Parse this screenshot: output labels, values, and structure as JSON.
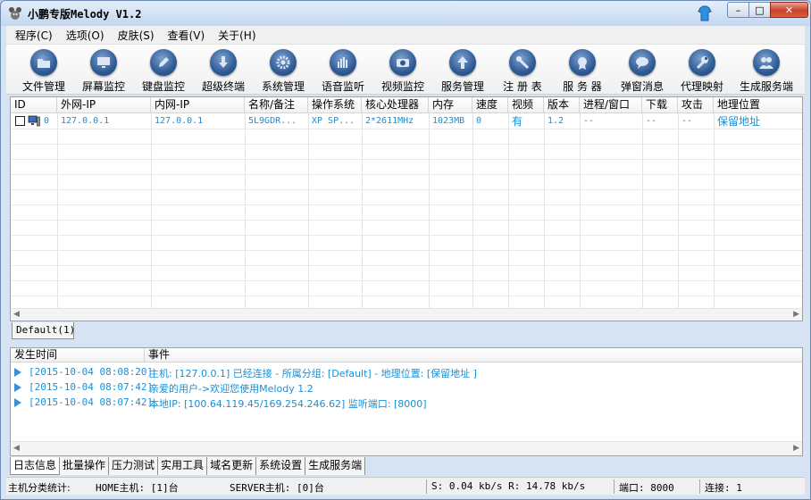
{
  "window": {
    "title": "小鹏专版Melody V1.2",
    "buttons": {
      "minimize": "–",
      "maximize": "□",
      "close": "✕"
    }
  },
  "menu": [
    {
      "label": "程序(C)"
    },
    {
      "label": "选项(O)"
    },
    {
      "label": "皮肤(S)"
    },
    {
      "label": "查看(V)"
    },
    {
      "label": "关于(H)"
    }
  ],
  "toolbar": [
    {
      "label": "文件管理",
      "icon": "folder-icon"
    },
    {
      "label": "屏幕监控",
      "icon": "monitor-icon"
    },
    {
      "label": "键盘监控",
      "icon": "pencil-icon"
    },
    {
      "label": "超级终端",
      "icon": "download-arrow-icon"
    },
    {
      "label": "系统管理",
      "icon": "gear-icon"
    },
    {
      "label": "语音监听",
      "icon": "equalizer-icon"
    },
    {
      "label": "视频监控",
      "icon": "camera-icon"
    },
    {
      "label": "服务管理",
      "icon": "up-arrow-icon"
    },
    {
      "label": "注 册 表",
      "icon": "tools-icon"
    },
    {
      "label": "服 务 器",
      "icon": "badge-icon"
    },
    {
      "label": "弹窗消息",
      "icon": "speech-bubble-icon"
    },
    {
      "label": "代理映射",
      "icon": "wrench-icon"
    },
    {
      "label": "生成服务端",
      "icon": "users-icon"
    }
  ],
  "client_table": {
    "columns": [
      "ID",
      "外网-IP",
      "内网-IP",
      "名称/备注",
      "操作系统",
      "核心处理器",
      "内存",
      "速度",
      "视频",
      "版本",
      "进程/窗口",
      "下载",
      "攻击",
      "地理位置"
    ],
    "rows": [
      {
        "id": "0",
        "wan_ip": "127.0.0.1",
        "lan_ip": "127.0.0.1",
        "name": "5L9GDR...",
        "os": "XP SP...",
        "cpu": "2*2611MHz",
        "memory": "1023MB",
        "speed": "0",
        "video": "有",
        "version": "1.2",
        "process": "--",
        "download": "--",
        "attack": "--",
        "location": "保留地址"
      }
    ],
    "group_tab": "Default(1)"
  },
  "log": {
    "columns": {
      "time": "发生时间",
      "event": "事件"
    },
    "entries": [
      {
        "time": "[2015-10-04 08:08:20]",
        "event": "主机: [127.0.0.1] 已经连接 - 所属分组: [Default] - 地理位置: [保留地址 ]"
      },
      {
        "time": "[2015-10-04 08:07:42]",
        "event": "亲爱的用户->欢迎您使用Melody 1.2"
      },
      {
        "time": "[2015-10-04 08:07:42]",
        "event": "本地IP: [100.64.119.45/169.254.246.62] 监听端口: [8000]"
      }
    ]
  },
  "bottom_tabs": [
    "日志信息",
    "批量操作",
    "压力测试",
    "实用工具",
    "域名更新",
    "系统设置",
    "生成服务端"
  ],
  "status": {
    "summary_label": "主机分类统计:",
    "home_hosts": "HOME主机: [1]台",
    "server_hosts": "SERVER主机: [0]台",
    "speed": "S: 0.04 kb/s R: 14.78 kb/s",
    "port": "端口: 8000",
    "connections": "连接: 1"
  },
  "colors": {
    "accent_text": "#1a8fd6",
    "toolbar_orb": "#2f5b95"
  }
}
